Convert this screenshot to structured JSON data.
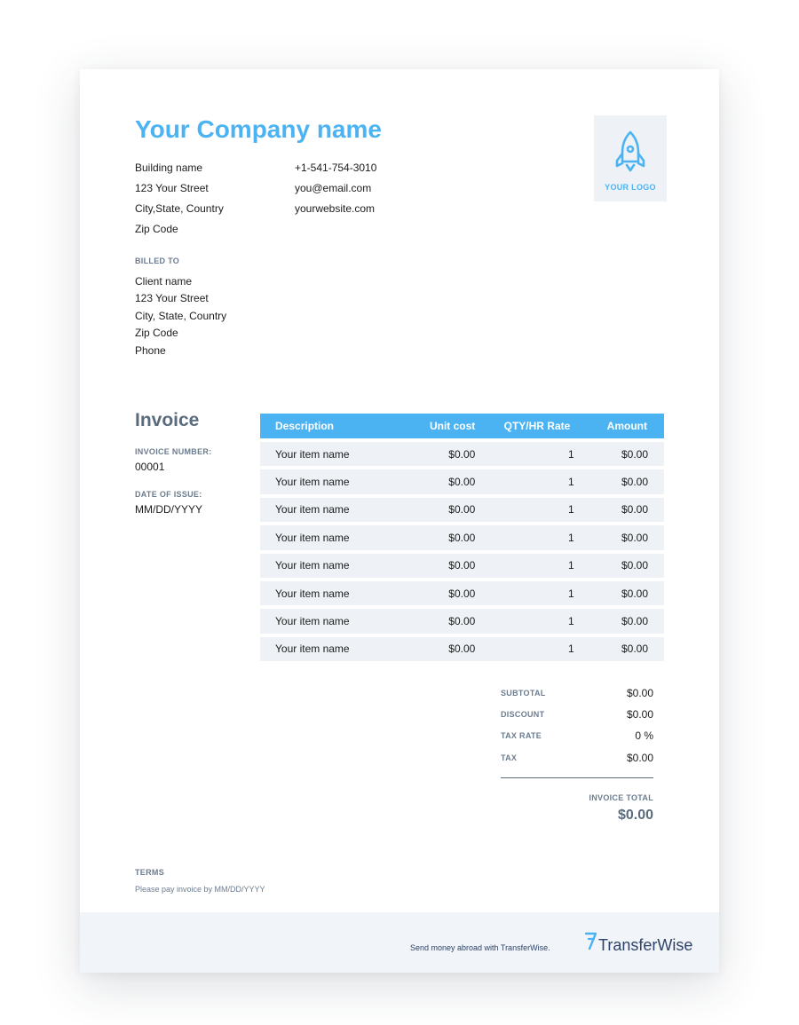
{
  "company": {
    "name": "Your Company name",
    "address_lines": [
      "Building name",
      "123 Your Street",
      "City,State, Country",
      "Zip Code"
    ],
    "contact_lines": [
      "+1-541-754-3010",
      "you@email.com",
      "yourwebsite.com"
    ],
    "logo_text": "YOUR LOGO"
  },
  "billed_to": {
    "label": "BILLED TO",
    "lines": [
      "Client name",
      "123 Your Street",
      "City, State, Country",
      "Zip Code",
      "Phone"
    ]
  },
  "invoice": {
    "title": "Invoice",
    "number_label": "INVOICE NUMBER:",
    "number": "00001",
    "issue_label": "DATE OF ISSUE:",
    "issue_date": "MM/DD/YYYY"
  },
  "table": {
    "headers": [
      "Description",
      "Unit cost",
      "QTY/HR Rate",
      "Amount"
    ],
    "rows": [
      [
        "Your item name",
        "$0.00",
        "1",
        "$0.00"
      ],
      [
        "Your item name",
        "$0.00",
        "1",
        "$0.00"
      ],
      [
        "Your item name",
        "$0.00",
        "1",
        "$0.00"
      ],
      [
        "Your item name",
        "$0.00",
        "1",
        "$0.00"
      ],
      [
        "Your item name",
        "$0.00",
        "1",
        "$0.00"
      ],
      [
        "Your item name",
        "$0.00",
        "1",
        "$0.00"
      ],
      [
        "Your item name",
        "$0.00",
        "1",
        "$0.00"
      ],
      [
        "Your item name",
        "$0.00",
        "1",
        "$0.00"
      ]
    ]
  },
  "summary": {
    "rows": [
      {
        "label": "SUBTOTAL",
        "value": "$0.00"
      },
      {
        "label": "DISCOUNT",
        "value": "$0.00"
      },
      {
        "label": "TAX RATE",
        "value": "0 %"
      },
      {
        "label": "TAX",
        "value": "$0.00"
      }
    ],
    "total_label": "INVOICE TOTAL",
    "total_value": "$0.00"
  },
  "terms": {
    "label": "TERMS",
    "text": "Please pay invoice by MM/DD/YYYY"
  },
  "footer": {
    "text": "Send money abroad with TransferWise.",
    "brand_name": "TransferWise"
  },
  "colors": {
    "accent": "#4cb3f2",
    "heading_gray": "#5a6b7d",
    "row_background": "#eef2f6",
    "brand_navy": "#2e4369"
  },
  "icons": [
    "rocket-icon",
    "transferwise-logo-icon"
  ]
}
